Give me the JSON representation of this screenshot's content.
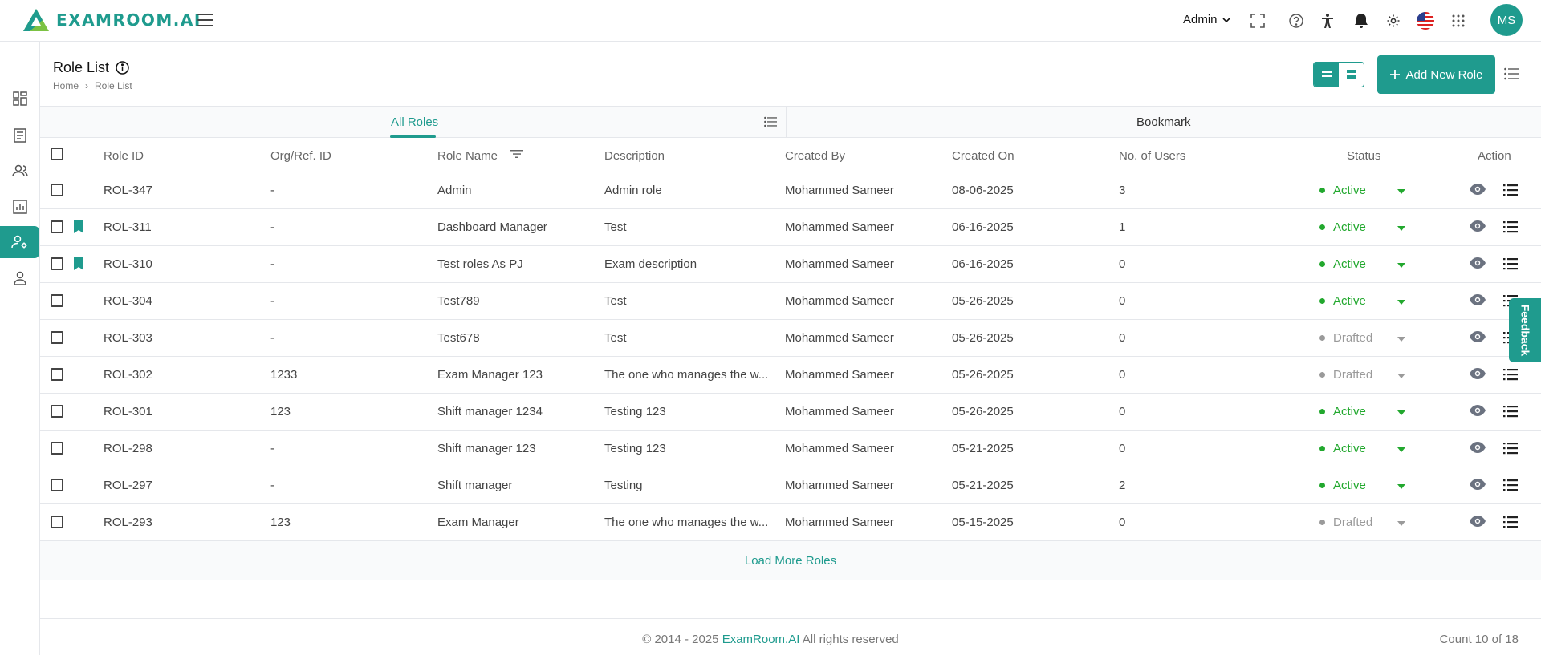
{
  "colors": {
    "accent": "#1f9b8e",
    "active": "#22a82e",
    "drafted": "#9a9a9a"
  },
  "header": {
    "logo_text": "EXAMROOM.AI",
    "user_menu": "Admin",
    "avatar_initials": "MS",
    "icons": [
      "fullscreen-icon",
      "help-icon",
      "accessibility-icon",
      "bell-icon",
      "gear-icon",
      "us-flag-icon",
      "apps-grid-icon"
    ]
  },
  "sidebar": {
    "items": [
      "dashboard-icon",
      "document-icon",
      "users-icon",
      "reports-icon",
      "roles-settings-icon",
      "user-icon"
    ],
    "active_index": 4
  },
  "page": {
    "title": "Role List",
    "breadcrumb": [
      "Home",
      "Role List"
    ],
    "add_button": "Add New Role"
  },
  "tabs": [
    "All Roles",
    "Bookmark"
  ],
  "table": {
    "columns": [
      "Role ID",
      "Org/Ref. ID",
      "Role Name",
      "Description",
      "Created By",
      "Created On",
      "No. of Users",
      "Status",
      "Action"
    ],
    "rows": [
      {
        "id": "ROL-347",
        "org": "-",
        "name": "Admin",
        "desc": "Admin role",
        "by": "Mohammed Sameer",
        "on": "08-06-2025",
        "users": "3",
        "status": "Active",
        "bookmarked": false
      },
      {
        "id": "ROL-311",
        "org": "-",
        "name": "Dashboard Manager",
        "desc": "Test",
        "by": "Mohammed Sameer",
        "on": "06-16-2025",
        "users": "1",
        "status": "Active",
        "bookmarked": true
      },
      {
        "id": "ROL-310",
        "org": "-",
        "name": "Test roles As PJ",
        "desc": "Exam description",
        "by": "Mohammed Sameer",
        "on": "06-16-2025",
        "users": "0",
        "status": "Active",
        "bookmarked": true
      },
      {
        "id": "ROL-304",
        "org": "-",
        "name": "Test789",
        "desc": "Test",
        "by": "Mohammed Sameer",
        "on": "05-26-2025",
        "users": "0",
        "status": "Active",
        "bookmarked": false
      },
      {
        "id": "ROL-303",
        "org": "-",
        "name": "Test678",
        "desc": "Test",
        "by": "Mohammed Sameer",
        "on": "05-26-2025",
        "users": "0",
        "status": "Drafted",
        "bookmarked": false
      },
      {
        "id": "ROL-302",
        "org": "1233",
        "name": "Exam Manager 123",
        "desc": "The one who manages the w...",
        "by": "Mohammed Sameer",
        "on": "05-26-2025",
        "users": "0",
        "status": "Drafted",
        "bookmarked": false
      },
      {
        "id": "ROL-301",
        "org": "123",
        "name": "Shift manager 1234",
        "desc": "Testing 123",
        "by": "Mohammed Sameer",
        "on": "05-26-2025",
        "users": "0",
        "status": "Active",
        "bookmarked": false
      },
      {
        "id": "ROL-298",
        "org": "-",
        "name": "Shift manager 123",
        "desc": "Testing 123",
        "by": "Mohammed Sameer",
        "on": "05-21-2025",
        "users": "0",
        "status": "Active",
        "bookmarked": false
      },
      {
        "id": "ROL-297",
        "org": "-",
        "name": "Shift manager",
        "desc": "Testing",
        "by": "Mohammed Sameer",
        "on": "05-21-2025",
        "users": "2",
        "status": "Active",
        "bookmarked": false
      },
      {
        "id": "ROL-293",
        "org": "123",
        "name": "Exam Manager",
        "desc": "The one who manages the w...",
        "by": "Mohammed Sameer",
        "on": "05-15-2025",
        "users": "0",
        "status": "Drafted",
        "bookmarked": false
      }
    ]
  },
  "load_more": "Load More Roles",
  "footer": {
    "prefix": "© 2014 - 2025",
    "brand": "ExamRoom.AI",
    "suffix": "All rights reserved",
    "count": "Count 10 of 18"
  },
  "feedback": "Feedback"
}
